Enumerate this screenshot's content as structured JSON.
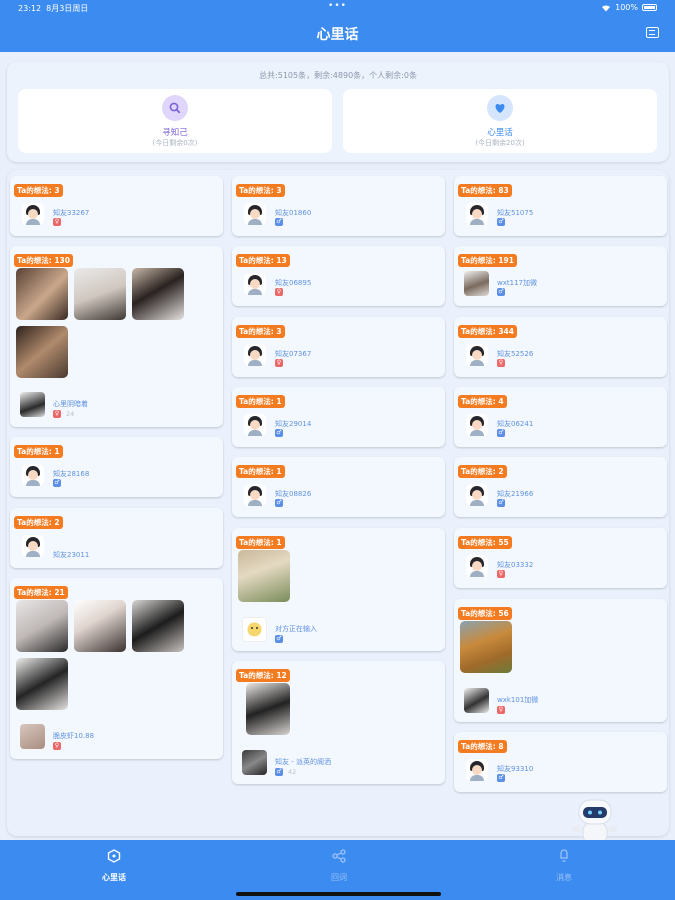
{
  "status_bar": {
    "time": "23:12",
    "date": "8月3日周日",
    "dots": "•••",
    "battery": "100%"
  },
  "header": {
    "title": "心里话",
    "icon": "inbox-icon"
  },
  "summary": "总共:5105条，剩余:4890条，个人剩余:0条",
  "actions": [
    {
      "label": "寻知己",
      "sub": "(今日剩余0次)",
      "icon": "search-icon"
    },
    {
      "label": "心里话",
      "sub": "(今日剩余20次)",
      "icon": "heart-icon"
    }
  ],
  "cards": [
    {
      "badge": "Ta的想法: 3",
      "user": "知友33267",
      "gender": "female"
    },
    {
      "badge": "Ta的想法: 130",
      "user": "心里阴暗着",
      "gender": "female",
      "count": "24"
    },
    {
      "badge": "Ta的想法: 1",
      "user": "知友28168",
      "gender": "male"
    },
    {
      "badge": "Ta的想法: 2",
      "user": "知友23011",
      "gender": "female"
    },
    {
      "badge": "Ta的想法: 21",
      "user": "脆皮虾10.88",
      "gender": "female"
    },
    {
      "badge": "Ta的想法: 3",
      "user": "知友01860",
      "gender": "male"
    },
    {
      "badge": "Ta的想法: 13",
      "user": "知友06895",
      "gender": "female"
    },
    {
      "badge": "Ta的想法: 3",
      "user": "知友07367",
      "gender": "female"
    },
    {
      "badge": "Ta的想法: 1",
      "user": "知友29014",
      "gender": "male"
    },
    {
      "badge": "Ta的想法: 1",
      "user": "知友08826",
      "gender": "male"
    },
    {
      "badge": "Ta的想法: 1",
      "user": "对方正在输入",
      "gender": "male"
    },
    {
      "badge": "Ta的想法: 12",
      "user": "知友 - 派英的阁洒",
      "gender": "male",
      "count": "42"
    },
    {
      "badge": "Ta的想法: 83",
      "user": "知友51075",
      "gender": "male"
    },
    {
      "badge": "Ta的想法: 191",
      "user": "wxt117加微",
      "gender": "male"
    },
    {
      "badge": "Ta的想法: 344",
      "user": "知友52526",
      "gender": "female"
    },
    {
      "badge": "Ta的想法: 4",
      "user": "知友06241",
      "gender": "male"
    },
    {
      "badge": "Ta的想法: 2",
      "user": "知友21966",
      "gender": "male"
    },
    {
      "badge": "Ta的想法: 55",
      "user": "知友03332",
      "gender": "female"
    },
    {
      "badge": "Ta的想法: 56",
      "user": "wxk101加微",
      "gender": "female"
    },
    {
      "badge": "Ta的想法: 8",
      "user": "知友93310",
      "gender": "male"
    }
  ],
  "tabs": [
    {
      "label": "心里话",
      "icon": "chat-bubble-icon",
      "active": true
    },
    {
      "label": "回词",
      "icon": "share-icon",
      "active": false
    },
    {
      "label": "消息",
      "icon": "bell-icon",
      "active": false
    }
  ],
  "colors": {
    "accent": "#3b8bf0",
    "badge": "#f47b20",
    "female": "#ec6868",
    "male": "#5b8ee6",
    "panel": "#eaf1fc"
  }
}
